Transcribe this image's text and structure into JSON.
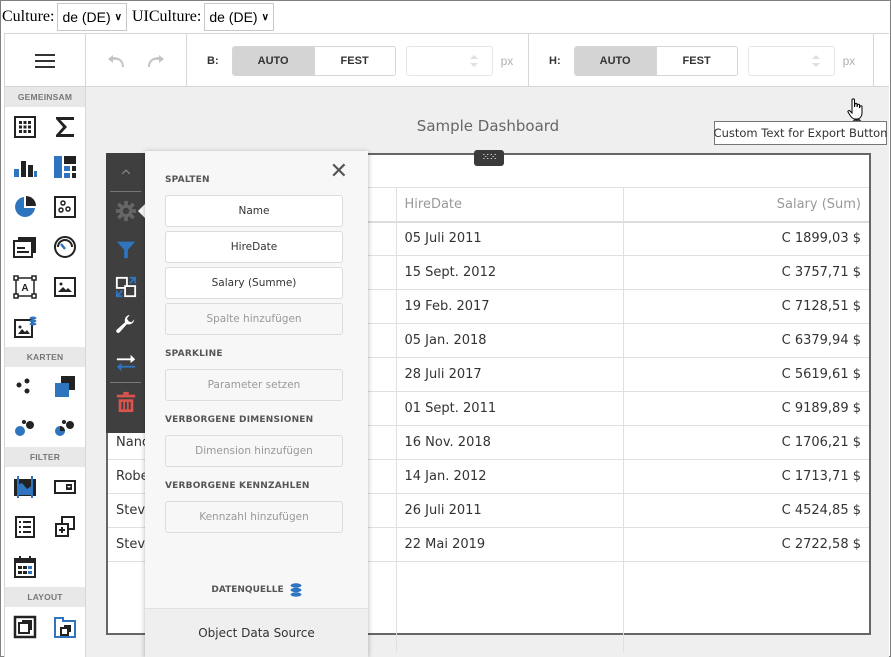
{
  "culture_bar": {
    "culture_label": "Culture:",
    "culture_value": "de (DE)",
    "uiculture_label": "UICulture:",
    "uiculture_value": "de (DE)"
  },
  "toolbar": {
    "width": {
      "axis_label": "B:",
      "auto_label": "AUTO",
      "fixed_label": "FEST",
      "active": "AUTO",
      "value": "",
      "unit": "px"
    },
    "height": {
      "axis_label": "H:",
      "auto_label": "AUTO",
      "fixed_label": "FEST",
      "active": "AUTO",
      "value": "",
      "unit": "px"
    }
  },
  "toolbox": {
    "sections": [
      {
        "title": "GEMEINSAM",
        "items": [
          "grid-icon",
          "card-sum-icon",
          "chart-icon",
          "treemap-icon",
          "pie-icon",
          "scatter-icon",
          "cards-icon",
          "gauge-icon",
          "text-box-icon",
          "image-icon",
          "bound-image-icon"
        ]
      },
      {
        "title": "KARTEN",
        "items": [
          "geo-point-map-icon",
          "choropleth-map-icon",
          "bubble-map-icon",
          "pie-map-icon"
        ]
      },
      {
        "title": "FILTER",
        "items": [
          "range-filter-icon",
          "combo-box-icon",
          "list-box-icon",
          "tree-view-icon",
          "date-filter-icon"
        ]
      },
      {
        "title": "LAYOUT",
        "items": [
          "group-icon",
          "tab-container-icon"
        ]
      }
    ]
  },
  "dashboard": {
    "title": "Sample Dashboard",
    "export_tooltip": "Custom Text for Export Button"
  },
  "grid": {
    "columns": [
      "Name",
      "HireDate",
      "Salary (Sum)"
    ],
    "header_visible": [
      "",
      "HireDate",
      "Salary (Sum)"
    ],
    "rows": [
      {
        "name": "",
        "hire_date": "05 Juli 2011",
        "salary": "C 1899,03 $"
      },
      {
        "name": "",
        "hire_date": "15 Sept. 2012",
        "salary": "C 3757,71 $"
      },
      {
        "name": "",
        "hire_date": "19 Feb. 2017",
        "salary": "C 7128,51 $"
      },
      {
        "name": "",
        "hire_date": "05 Jan. 2018",
        "salary": "C 6379,94 $"
      },
      {
        "name": "",
        "hire_date": "28 Juli 2017",
        "salary": "C 5619,61 $"
      },
      {
        "name": "",
        "hire_date": "01 Sept. 2011",
        "salary": "C 9189,89 $"
      },
      {
        "name": "Nanc",
        "hire_date": "16 Nov. 2018",
        "salary": "C 1706,21 $"
      },
      {
        "name": "Robe",
        "hire_date": "14 Jan. 2012",
        "salary": "C 1713,71 $"
      },
      {
        "name": "Steve",
        "hire_date": "26 Juli 2011",
        "salary": "C 4524,85 $"
      },
      {
        "name": "Steve",
        "hire_date": "22 Mai 2019",
        "salary": "C 2722,58 $"
      }
    ]
  },
  "item_menu": {
    "items": [
      "collapse-up-icon",
      "gear-icon",
      "filter-icon",
      "convert-icon",
      "wrench-icon",
      "swap-icon",
      "delete-icon"
    ],
    "colors": {
      "accent": "#2f74bf",
      "delete": "#d9534f",
      "background": "#3f3f3f"
    }
  },
  "binding_panel": {
    "sections": {
      "columns_title": "SPALTEN",
      "sparkline_title": "SPARKLINE",
      "hidden_dimensions_title": "VERBORGENE DIMENSIONEN",
      "hidden_measures_title": "VERBORGENE KENNZAHLEN",
      "datasource_title": "DATENQUELLE"
    },
    "columns": [
      "Name",
      "HireDate",
      "Salary (Summe)"
    ],
    "add_column": "Spalte hinzufügen",
    "sparkline_placeholder": "Parameter setzen",
    "add_dimension": "Dimension hinzufügen",
    "add_measure": "Kennzahl hinzufügen",
    "datasource_name": "Object Data Source"
  }
}
